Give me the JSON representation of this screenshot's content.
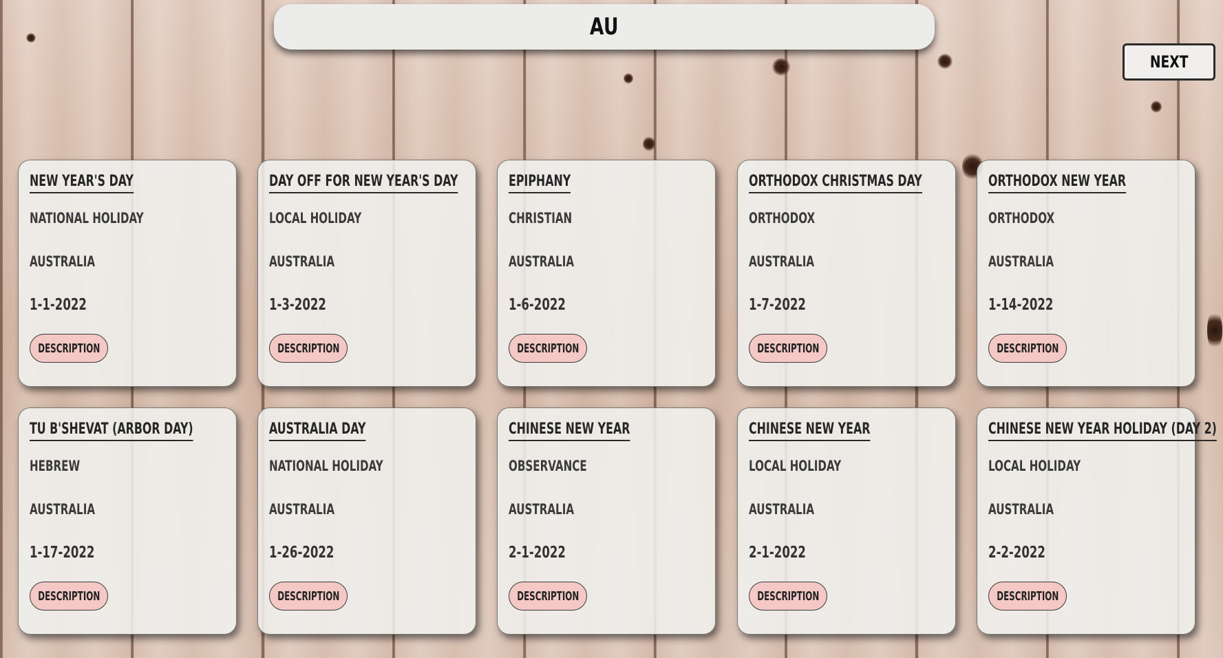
{
  "header": {
    "title": "AU"
  },
  "nav": {
    "next_label": "Next"
  },
  "cards": [
    {
      "name": "New Year's Day",
      "type": "National holiday",
      "country": "Australia",
      "date": "1-1-2022",
      "button": "Description"
    },
    {
      "name": "Day off for New Year's Day",
      "type": "Local holiday",
      "country": "Australia",
      "date": "1-3-2022",
      "button": "Description"
    },
    {
      "name": "Epiphany",
      "type": "Christian",
      "country": "Australia",
      "date": "1-6-2022",
      "button": "Description"
    },
    {
      "name": "Orthodox Christmas Day",
      "type": "Orthodox",
      "country": "Australia",
      "date": "1-7-2022",
      "button": "Description"
    },
    {
      "name": "Orthodox New Year",
      "type": "Orthodox",
      "country": "Australia",
      "date": "1-14-2022",
      "button": "Description"
    },
    {
      "name": "Tu B'Shevat (Arbor Day)",
      "type": "Hebrew",
      "country": "Australia",
      "date": "1-17-2022",
      "button": "Description"
    },
    {
      "name": "Australia Day",
      "type": "National holiday",
      "country": "Australia",
      "date": "1-26-2022",
      "button": "Description"
    },
    {
      "name": "Chinese New Year",
      "type": "Observance",
      "country": "Australia",
      "date": "2-1-2022",
      "button": "Description"
    },
    {
      "name": "Chinese New Year",
      "type": "Local holiday",
      "country": "Australia",
      "date": "2-1-2022",
      "button": "Description"
    },
    {
      "name": "Chinese New Year Holiday (Day 2)",
      "type": "Local holiday",
      "country": "Australia",
      "date": "2-2-2022",
      "button": "Description"
    }
  ],
  "colors": {
    "card_bg": "#f0f0ee",
    "button_bg": "#f4c8c4",
    "wood": "#d9c2b3"
  },
  "icons": []
}
